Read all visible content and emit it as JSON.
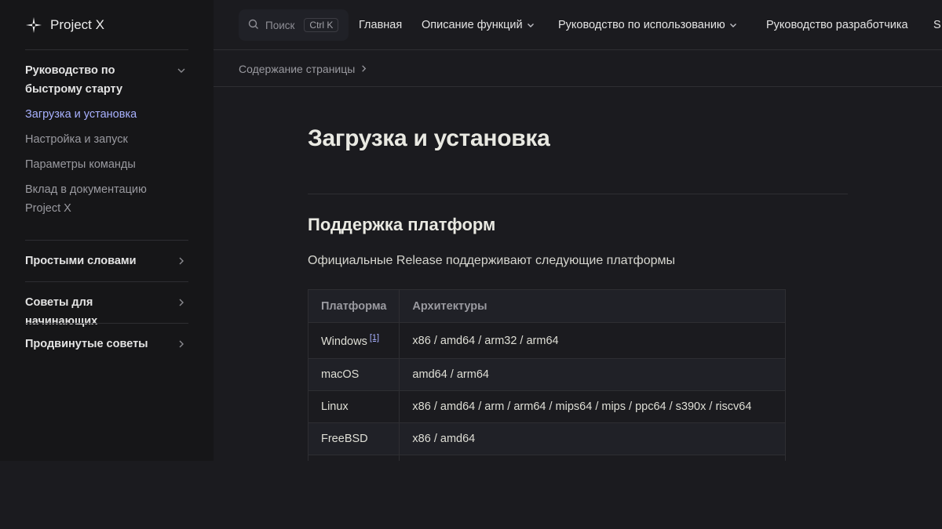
{
  "brand": {
    "name": "Project X"
  },
  "search": {
    "placeholder": "Поиск",
    "shortcut": "Ctrl K"
  },
  "nav": {
    "items": [
      {
        "label": "Главная",
        "has_dropdown": false
      },
      {
        "label": "Описание функций",
        "has_dropdown": true
      },
      {
        "label": "Руководство по использованию",
        "has_dropdown": true
      },
      {
        "label": "Руководство разработчика",
        "has_dropdown": false
      },
      {
        "label": "S",
        "has_dropdown": false
      }
    ]
  },
  "local_nav": {
    "label": "Содержание страницы"
  },
  "sidebar": {
    "group": {
      "title": "Руководство по быстрому старту",
      "items": [
        {
          "label": "Загрузка и установка",
          "active": true
        },
        {
          "label": "Настройка и запуск",
          "active": false
        },
        {
          "label": "Параметры команды",
          "active": false
        },
        {
          "label": "Вклад в документацию Project X",
          "active": false
        }
      ]
    },
    "sections": [
      {
        "label": "Простыми словами"
      },
      {
        "label": "Советы для начинающих"
      },
      {
        "label": "Продвинутые советы"
      }
    ]
  },
  "page": {
    "title": "Загрузка и установка",
    "section_title": "Поддержка платформ",
    "intro": "Официальные Release поддерживают следующие платформы"
  },
  "table": {
    "headers": [
      "Платформа",
      "Архитектуры"
    ],
    "rows": [
      {
        "platform": "Windows",
        "footnote": "[1]",
        "arch": "x86 / amd64 / arm32 / arm64"
      },
      {
        "platform": "macOS",
        "arch": "amd64 / arm64"
      },
      {
        "platform": "Linux",
        "arch": "x86 / amd64 / arm / arm64 / mips64 / mips / ppc64 / s390x / riscv64"
      },
      {
        "platform": "FreeBSD",
        "arch": "x86 / amd64"
      }
    ]
  },
  "colors": {
    "background": "#1b1b1f",
    "sidebar": "#161618",
    "accent": "#a8b1ff",
    "text": "#dfdfd6",
    "muted": "#9a9aa0"
  }
}
